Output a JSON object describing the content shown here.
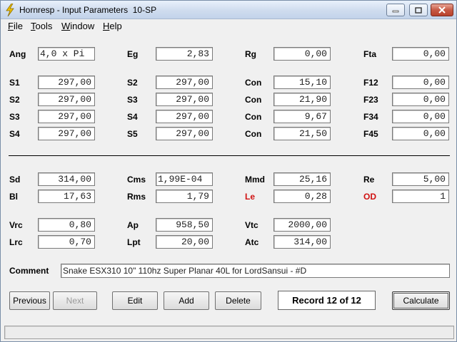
{
  "window": {
    "title": "Hornresp - Input Parameters  10-SP"
  },
  "menu": [
    {
      "label": "File",
      "mnemonic": "F",
      "rest": "ile"
    },
    {
      "label": "Tools",
      "mnemonic": "T",
      "rest": "ools"
    },
    {
      "label": "Window",
      "mnemonic": "W",
      "rest": "indow"
    },
    {
      "label": "Help",
      "mnemonic": "H",
      "rest": "elp"
    }
  ],
  "params": {
    "ang": {
      "label": "Ang",
      "value": "4,0 x Pi"
    },
    "eg": {
      "label": "Eg",
      "value": "2,83"
    },
    "rg": {
      "label": "Rg",
      "value": "0,00"
    },
    "fta": {
      "label": "Fta",
      "value": "0,00"
    },
    "s1a": {
      "label": "S1",
      "value": "297,00"
    },
    "s2b": {
      "label": "S2",
      "value": "297,00"
    },
    "con1": {
      "label": "Con",
      "value": "15,10"
    },
    "f12": {
      "label": "F12",
      "value": "0,00"
    },
    "s2a": {
      "label": "S2",
      "value": "297,00"
    },
    "s3b": {
      "label": "S3",
      "value": "297,00"
    },
    "con2": {
      "label": "Con",
      "value": "21,90"
    },
    "f23": {
      "label": "F23",
      "value": "0,00"
    },
    "s3a": {
      "label": "S3",
      "value": "297,00"
    },
    "s4b": {
      "label": "S4",
      "value": "297,00"
    },
    "con3": {
      "label": "Con",
      "value": "9,67"
    },
    "f34": {
      "label": "F34",
      "value": "0,00"
    },
    "s4a": {
      "label": "S4",
      "value": "297,00"
    },
    "s5b": {
      "label": "S5",
      "value": "297,00"
    },
    "con4": {
      "label": "Con",
      "value": "21,50"
    },
    "f45": {
      "label": "F45",
      "value": "0,00"
    },
    "sd": {
      "label": "Sd",
      "value": "314,00"
    },
    "cms": {
      "label": "Cms",
      "value": "1,99E-04"
    },
    "mmd": {
      "label": "Mmd",
      "value": "25,16"
    },
    "re": {
      "label": "Re",
      "value": "5,00"
    },
    "bl": {
      "label": "Bl",
      "value": "17,63"
    },
    "rms": {
      "label": "Rms",
      "value": "1,79"
    },
    "le": {
      "label": "Le",
      "value": "0,28"
    },
    "od": {
      "label": "OD",
      "value": "1"
    },
    "vrc": {
      "label": "Vrc",
      "value": "0,80"
    },
    "ap": {
      "label": "Ap",
      "value": "958,50"
    },
    "vtc": {
      "label": "Vtc",
      "value": "2000,00"
    },
    "lrc": {
      "label": "Lrc",
      "value": "0,70"
    },
    "lpt": {
      "label": "Lpt",
      "value": "20,00"
    },
    "atc": {
      "label": "Atc",
      "value": "314,00"
    }
  },
  "comment": {
    "label": "Comment",
    "value": "Snake ESX310 10\"  110hz Super Planar 40L for LordSansui - #D"
  },
  "buttons": {
    "previous": "Previous",
    "next": "Next",
    "edit": "Edit",
    "add": "Add",
    "delete": "Delete",
    "calculate": "Calculate"
  },
  "record": "Record 12 of 12",
  "colors": {
    "highlight_label": "#d01010",
    "close_button": "#c75a45"
  }
}
